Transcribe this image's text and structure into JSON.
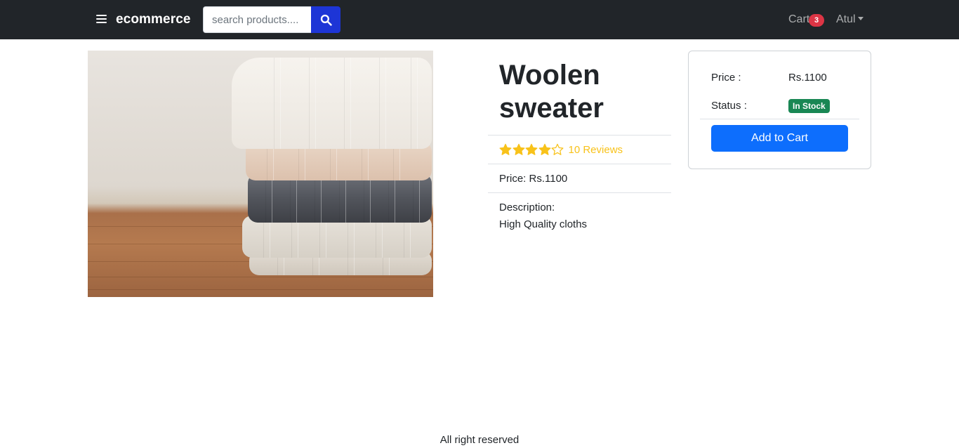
{
  "navbar": {
    "menu_icon": "hamburger-menu-icon",
    "brand": "ecommerce",
    "search_placeholder": "search products....",
    "search_icon": "search-icon",
    "cart_label": "Cart",
    "cart_count": "3",
    "user_name": "Atul",
    "user_menu_icon": "caret-down-icon",
    "colors": {
      "background": "#212529",
      "search_button": "#1d35d6",
      "badge": "#dc3545"
    }
  },
  "product": {
    "image_subject": "stack of knitted woolen sweaters",
    "title": "Woolen sweater",
    "rating": 4,
    "rating_max": 5,
    "reviews_text": "10 Reviews",
    "price_text": "Price: Rs.1100",
    "description_label": "Description:",
    "description": "High Quality cloths"
  },
  "purchase_card": {
    "price_label": "Price :",
    "price_value": "Rs.1100",
    "status_label": "Status :",
    "status_value": "In Stock",
    "add_to_cart_label": "Add to Cart",
    "colors": {
      "in_stock": "#198754",
      "button": "#0d6efd",
      "star": "#f8c21a"
    }
  },
  "footer": {
    "text": "All right reserved"
  }
}
